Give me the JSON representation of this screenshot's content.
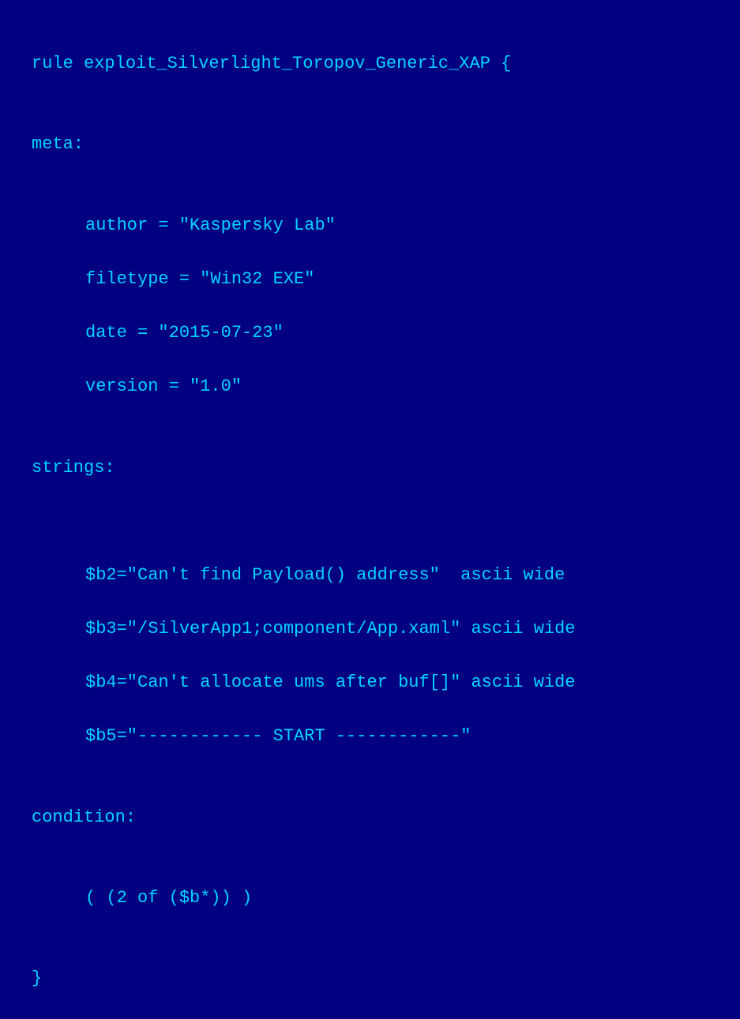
{
  "line1": "rule exploit_Silverlight_Toropov_Generic_XAP {",
  "blank": "",
  "line2": "meta:",
  "meta_author": "author = \"Kaspersky Lab\"",
  "meta_filetype": "filetype = \"Win32 EXE\"",
  "meta_date": "date = \"2015-07-23\"",
  "meta_version": "version = \"1.0\"",
  "line_strings": "strings:",
  "str_b2": "$b2=\"Can't find Payload() address\"  ascii wide",
  "str_b3": "$b3=\"/SilverApp1;component/App.xaml\" ascii wide",
  "str_b4": "$b4=\"Can't allocate ums after buf[]\" ascii wide",
  "str_b5": "$b5=\"------------ START ------------\"",
  "line_condition": "condition:",
  "cond_expr": "( (2 of ($b*)) )",
  "line_close": "}"
}
